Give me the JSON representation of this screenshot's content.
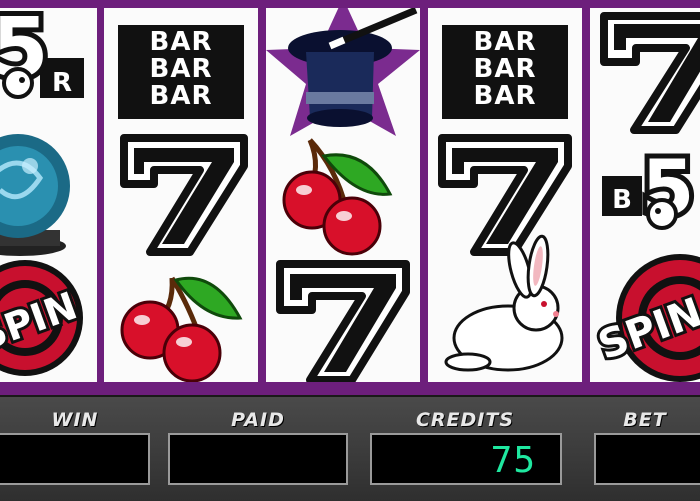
{
  "reels": {
    "reel1": {
      "symbols": [
        "5",
        "R",
        "SPIN"
      ]
    },
    "reel2": {
      "bar_text": [
        "BAR",
        "BAR",
        "BAR"
      ],
      "seven": "7"
    },
    "reel3": {
      "seven": "7"
    },
    "reel4": {
      "bar_text": [
        "BAR",
        "BAR",
        "BAR"
      ],
      "seven": "7"
    },
    "reel5": {
      "top": "7",
      "mid": [
        "B",
        "5"
      ],
      "spin": "SPIN"
    }
  },
  "meters": {
    "win": {
      "label": "WIN",
      "value": ""
    },
    "paid": {
      "label": "PAID",
      "value": ""
    },
    "credits": {
      "label": "CREDITS",
      "value": "75"
    },
    "bet": {
      "label": "BET",
      "value": ""
    }
  },
  "colors": {
    "frame": "#6d1f7c",
    "reel_bg": "#fbfbfb",
    "digits": "#1fe8a0",
    "cherry": "#d8102a",
    "star": "#7b2b8f"
  }
}
